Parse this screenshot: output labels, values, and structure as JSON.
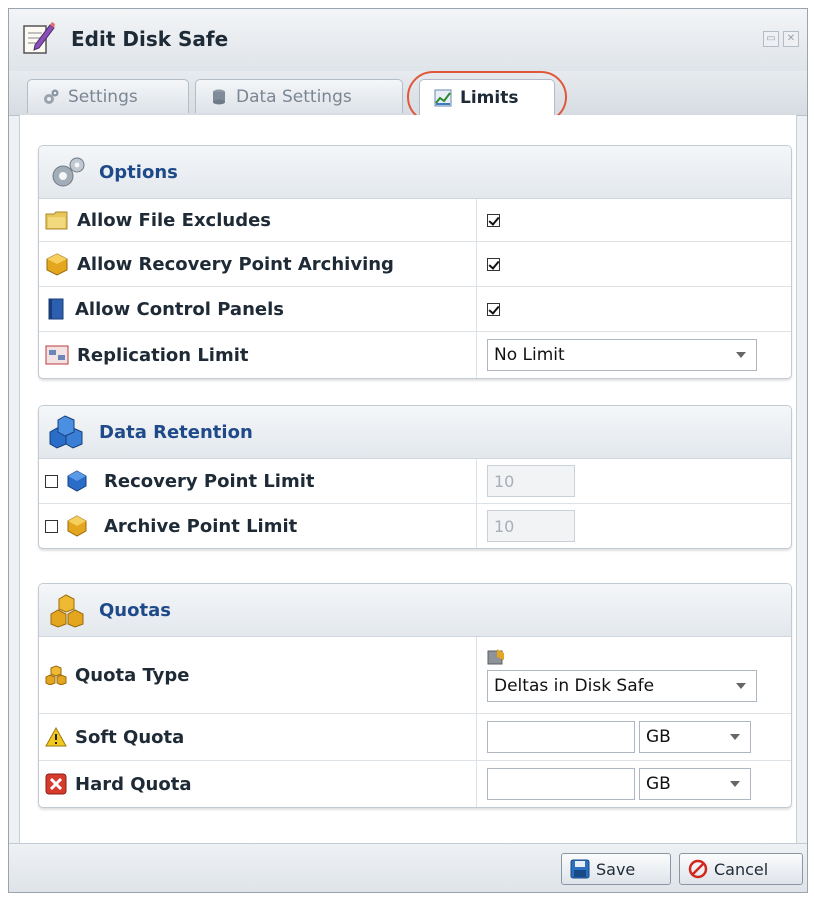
{
  "window": {
    "title": "Edit Disk Safe"
  },
  "tabs": [
    {
      "label": "Settings"
    },
    {
      "label": "Data Settings"
    },
    {
      "label": "Limits"
    }
  ],
  "options": {
    "header": "Options",
    "rows": [
      {
        "label": "Allow File Excludes",
        "checked": true
      },
      {
        "label": "Allow Recovery Point Archiving",
        "checked": true
      },
      {
        "label": "Allow Control Panels",
        "checked": true
      },
      {
        "label": "Replication Limit",
        "value": "No Limit"
      }
    ]
  },
  "retention": {
    "header": "Data Retention",
    "rows": [
      {
        "label": "Recovery Point Limit",
        "checked": false,
        "value": "10"
      },
      {
        "label": "Archive Point Limit",
        "checked": false,
        "value": "10"
      }
    ]
  },
  "quotas": {
    "header": "Quotas",
    "rows": [
      {
        "label": "Quota Type",
        "value": "Deltas in Disk Safe"
      },
      {
        "label": "Soft Quota",
        "value": "",
        "unit": "GB"
      },
      {
        "label": "Hard Quota",
        "value": "",
        "unit": "GB"
      }
    ]
  },
  "footer": {
    "save_label": "Save",
    "cancel_label": "Cancel"
  },
  "colors": {
    "accent": "#1f4a8a",
    "highlight": "#e0573a"
  }
}
